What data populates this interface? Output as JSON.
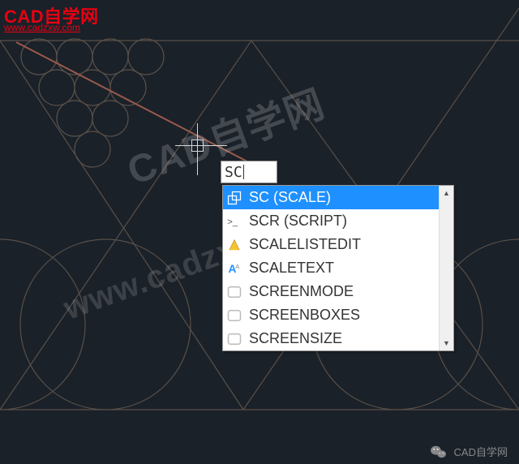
{
  "watermark": {
    "brand": "CAD自学网",
    "url": "www.cadzxw.com",
    "center1": "CAD自学网",
    "center2": "www.cadzxw.com"
  },
  "command_input": {
    "value": "SC"
  },
  "autocomplete": {
    "items": [
      {
        "label": "SC (SCALE)",
        "icon": "scale",
        "selected": true
      },
      {
        "label": "SCR (SCRIPT)",
        "icon": "script",
        "selected": false
      },
      {
        "label": "SCALELISTEDIT",
        "icon": "scalelist",
        "selected": false
      },
      {
        "label": "SCALETEXT",
        "icon": "scaletext",
        "selected": false
      },
      {
        "label": "SCREENMODE",
        "icon": "var",
        "selected": false
      },
      {
        "label": "SCREENBOXES",
        "icon": "var",
        "selected": false
      },
      {
        "label": "SCREENSIZE",
        "icon": "var",
        "selected": false
      }
    ]
  },
  "footer": {
    "label": "CAD自学网"
  },
  "colors": {
    "brand_red": "#e60012",
    "selection_blue": "#1e90ff",
    "canvas_bg": "#1a2129",
    "line_dark": "#4a4a4a",
    "line_brown": "#9a5a4c"
  }
}
